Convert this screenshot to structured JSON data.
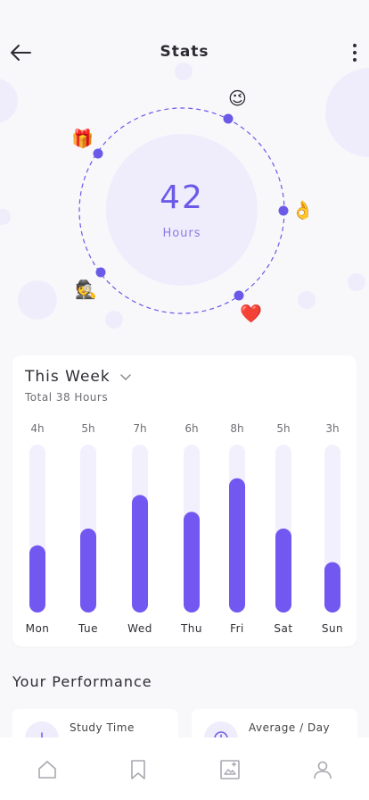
{
  "header": {
    "title": "Stats",
    "back_icon": "arrow-left-icon",
    "menu_icon": "more-vertical-icon"
  },
  "summary": {
    "value": "42",
    "unit": "Hours"
  },
  "orbit_emojis": [
    "😉",
    "👌",
    "❤️",
    "🕵️",
    "🎁"
  ],
  "weekly": {
    "period": "This Week",
    "total": "Total 38 Hours"
  },
  "chart_data": {
    "type": "bar",
    "categories": [
      "Mon",
      "Tue",
      "Wed",
      "Thu",
      "Fri",
      "Sat",
      "Sun"
    ],
    "value_labels": [
      "4h",
      "5h",
      "7h",
      "6h",
      "8h",
      "5h",
      "3h"
    ],
    "values": [
      4,
      5,
      7,
      6,
      8,
      5,
      3
    ],
    "ylim": [
      0,
      10
    ],
    "bar_color": "#7257f0",
    "track_color": "#f2f0fc"
  },
  "performance": {
    "title": "Your Performance",
    "cards": [
      {
        "label": "Study Time",
        "icon": "download-icon"
      },
      {
        "label": "Average / Day",
        "icon": "clock-icon"
      }
    ]
  },
  "nav": {
    "items": [
      "home-icon",
      "bookmark-icon",
      "news-icon",
      "profile-icon"
    ]
  },
  "colors": {
    "accent": "#6b5ae8",
    "accent_light": "#efedfc",
    "background": "#f8f8fa"
  }
}
